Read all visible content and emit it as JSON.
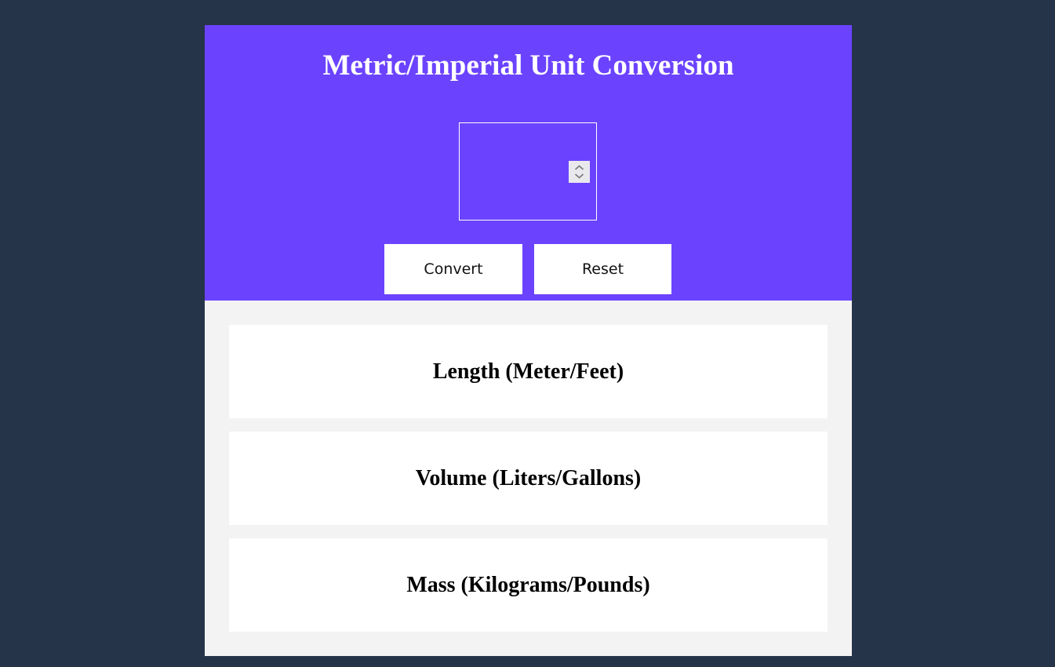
{
  "header": {
    "title": "Metric/Imperial Unit Conversion"
  },
  "input": {
    "value": "",
    "placeholder": ""
  },
  "buttons": {
    "convert_label": "Convert",
    "reset_label": "Reset"
  },
  "results": [
    {
      "title": "Length (Meter/Feet)"
    },
    {
      "title": "Volume (Liters/Gallons)"
    },
    {
      "title": "Mass (Kilograms/Pounds)"
    }
  ],
  "colors": {
    "page_background": "#263449",
    "hero_background": "#6b43fe",
    "panel_background": "#f3f3f3",
    "card_background": "#ffffff"
  },
  "icons": {
    "spinner": "chevron-up-down-icon"
  }
}
